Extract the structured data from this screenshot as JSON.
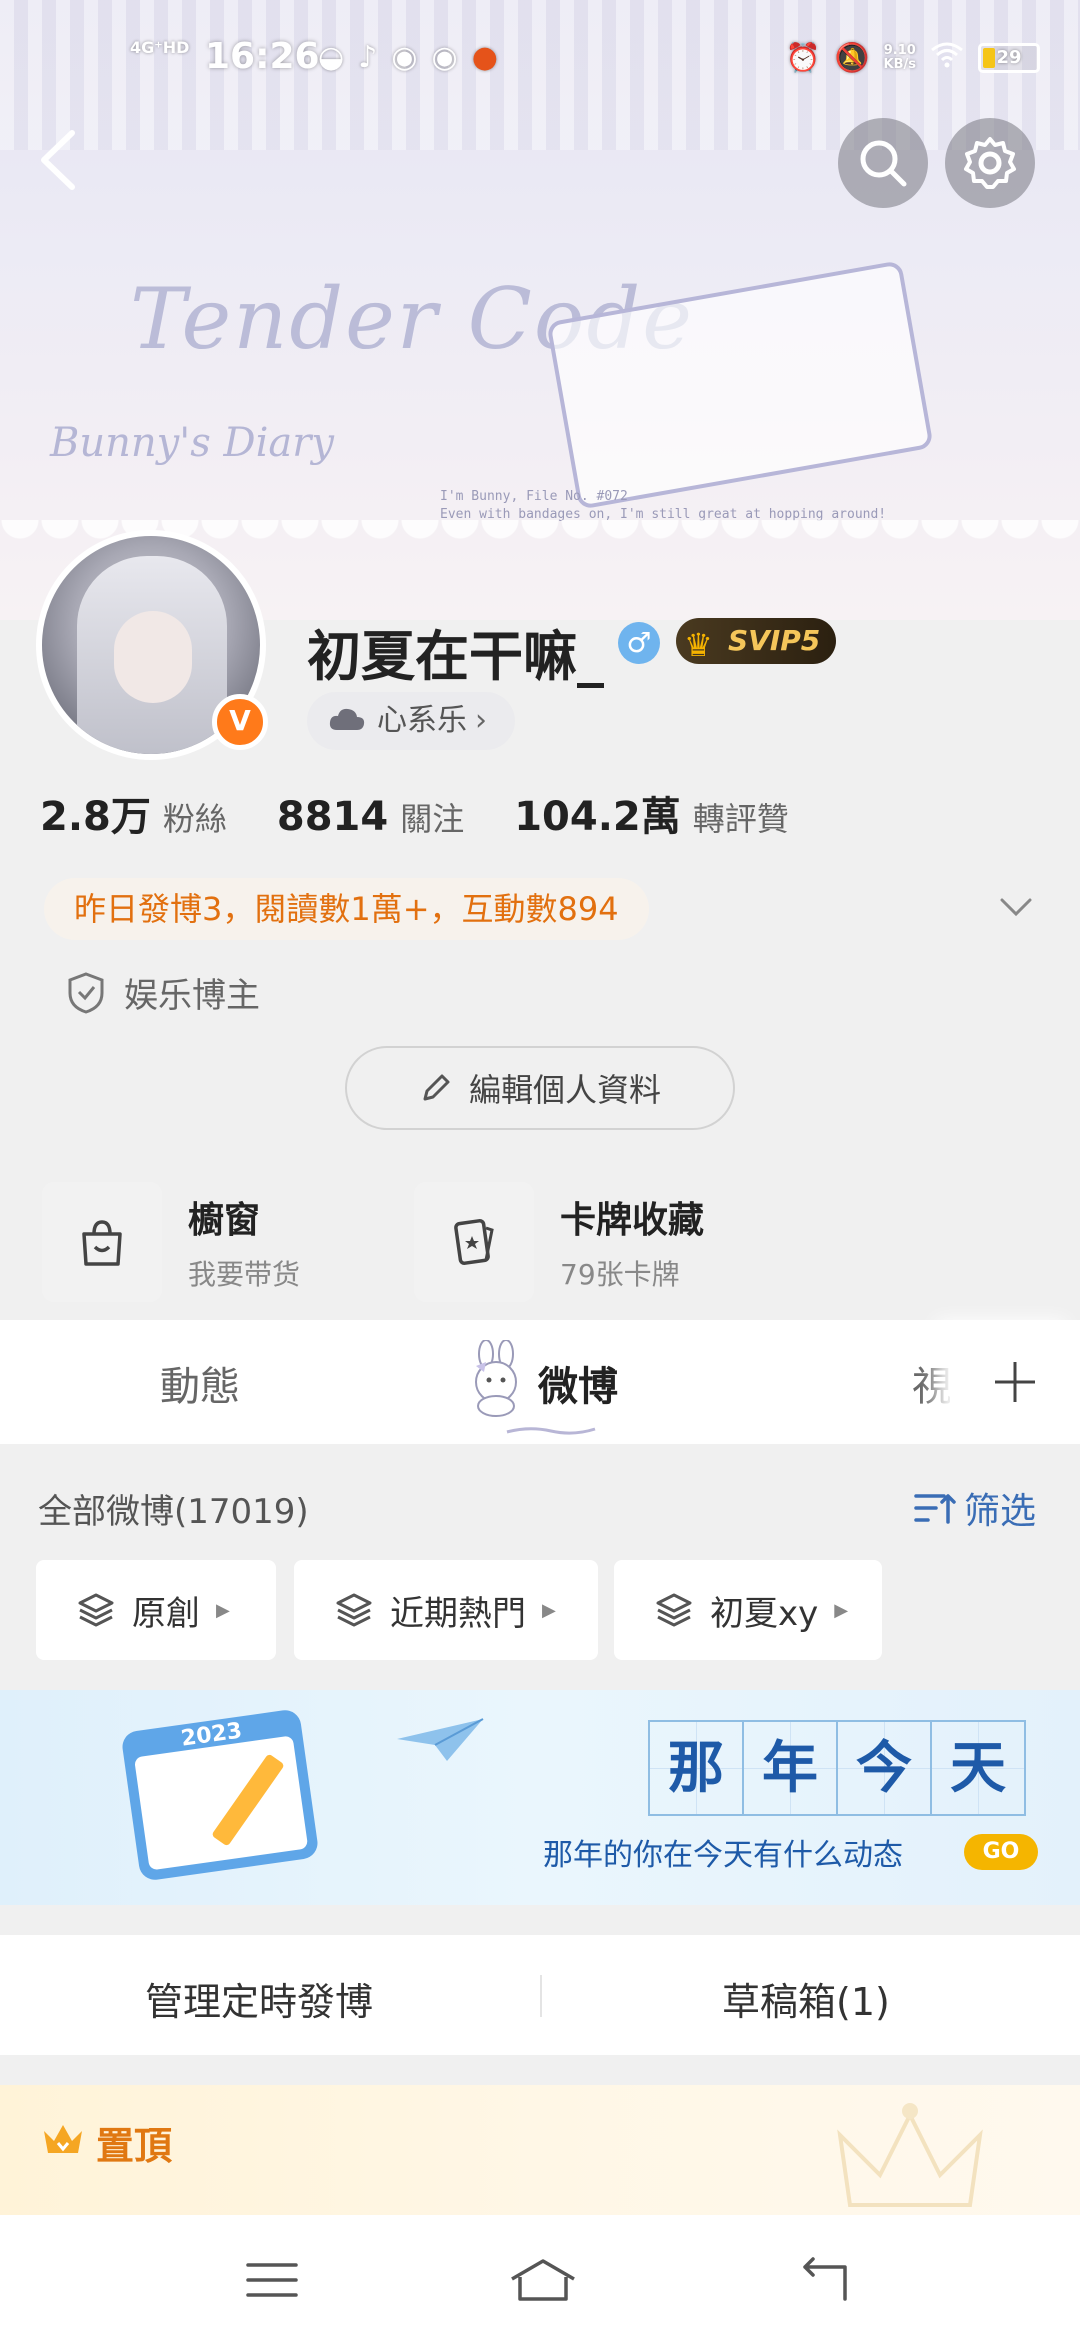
{
  "status_bar": {
    "time": "16:26",
    "signal": "4G⁺HD",
    "network_speed_value": "9.10",
    "network_speed_unit": "KB/s",
    "battery": "29",
    "battery_level": 0.29,
    "notification_icons": [
      "qq-icon",
      "tiktok-icon",
      "weibo-icon",
      "weibo-icon",
      "halloween-icon"
    ]
  },
  "banner": {
    "title": "Tender Code",
    "subtitle": "Bunny's Diary",
    "note_line1": "I'm Bunny, File No. #072",
    "note_line2": "Even with bandages on, I'm still great at hopping around!"
  },
  "profile": {
    "username": "初夏在干嘛_",
    "gender_symbol": "♂",
    "vip_label": "SVIP5",
    "verified_badge": "V",
    "tag_label": "心系乐",
    "tag_chevron": "›",
    "stats": [
      {
        "value": "2.8万",
        "label": "粉絲"
      },
      {
        "value": "8814",
        "label": "關注"
      },
      {
        "value": "104.2萬",
        "label": "轉評贊"
      }
    ],
    "activity": "昨日發博3，閱讀數1萬+，互動數894",
    "role": "娱乐博主",
    "edit_button": "編輯個人資料"
  },
  "features": [
    {
      "title": "櫥窗",
      "subtitle": "我要带货",
      "icon": "shopping-bag-icon"
    },
    {
      "title": "卡牌收藏",
      "subtitle": "79张卡牌",
      "icon": "card-icon"
    }
  ],
  "tabs": {
    "items": [
      "動態",
      "微博",
      "視"
    ],
    "active_index": 1
  },
  "filter": {
    "all_label": "全部微博(17019)",
    "filter_button": "筛选",
    "chips": [
      "原創",
      "近期熱門",
      "初夏xy"
    ]
  },
  "memory": {
    "title_chars": [
      "那",
      "年",
      "今",
      "天"
    ],
    "subtitle": "那年的你在今天有什么动态",
    "go_label": "GO",
    "calendar_year": "2023"
  },
  "actions": {
    "scheduled": "管理定時發博",
    "drafts": "草稿箱(1)"
  },
  "pinned": {
    "label": "置頂"
  },
  "colors": {
    "accent_orange": "#e2700f",
    "link_blue": "#3a6db5",
    "vip_gold": "#f5c65a",
    "verified_orange": "#ff7a1a"
  }
}
